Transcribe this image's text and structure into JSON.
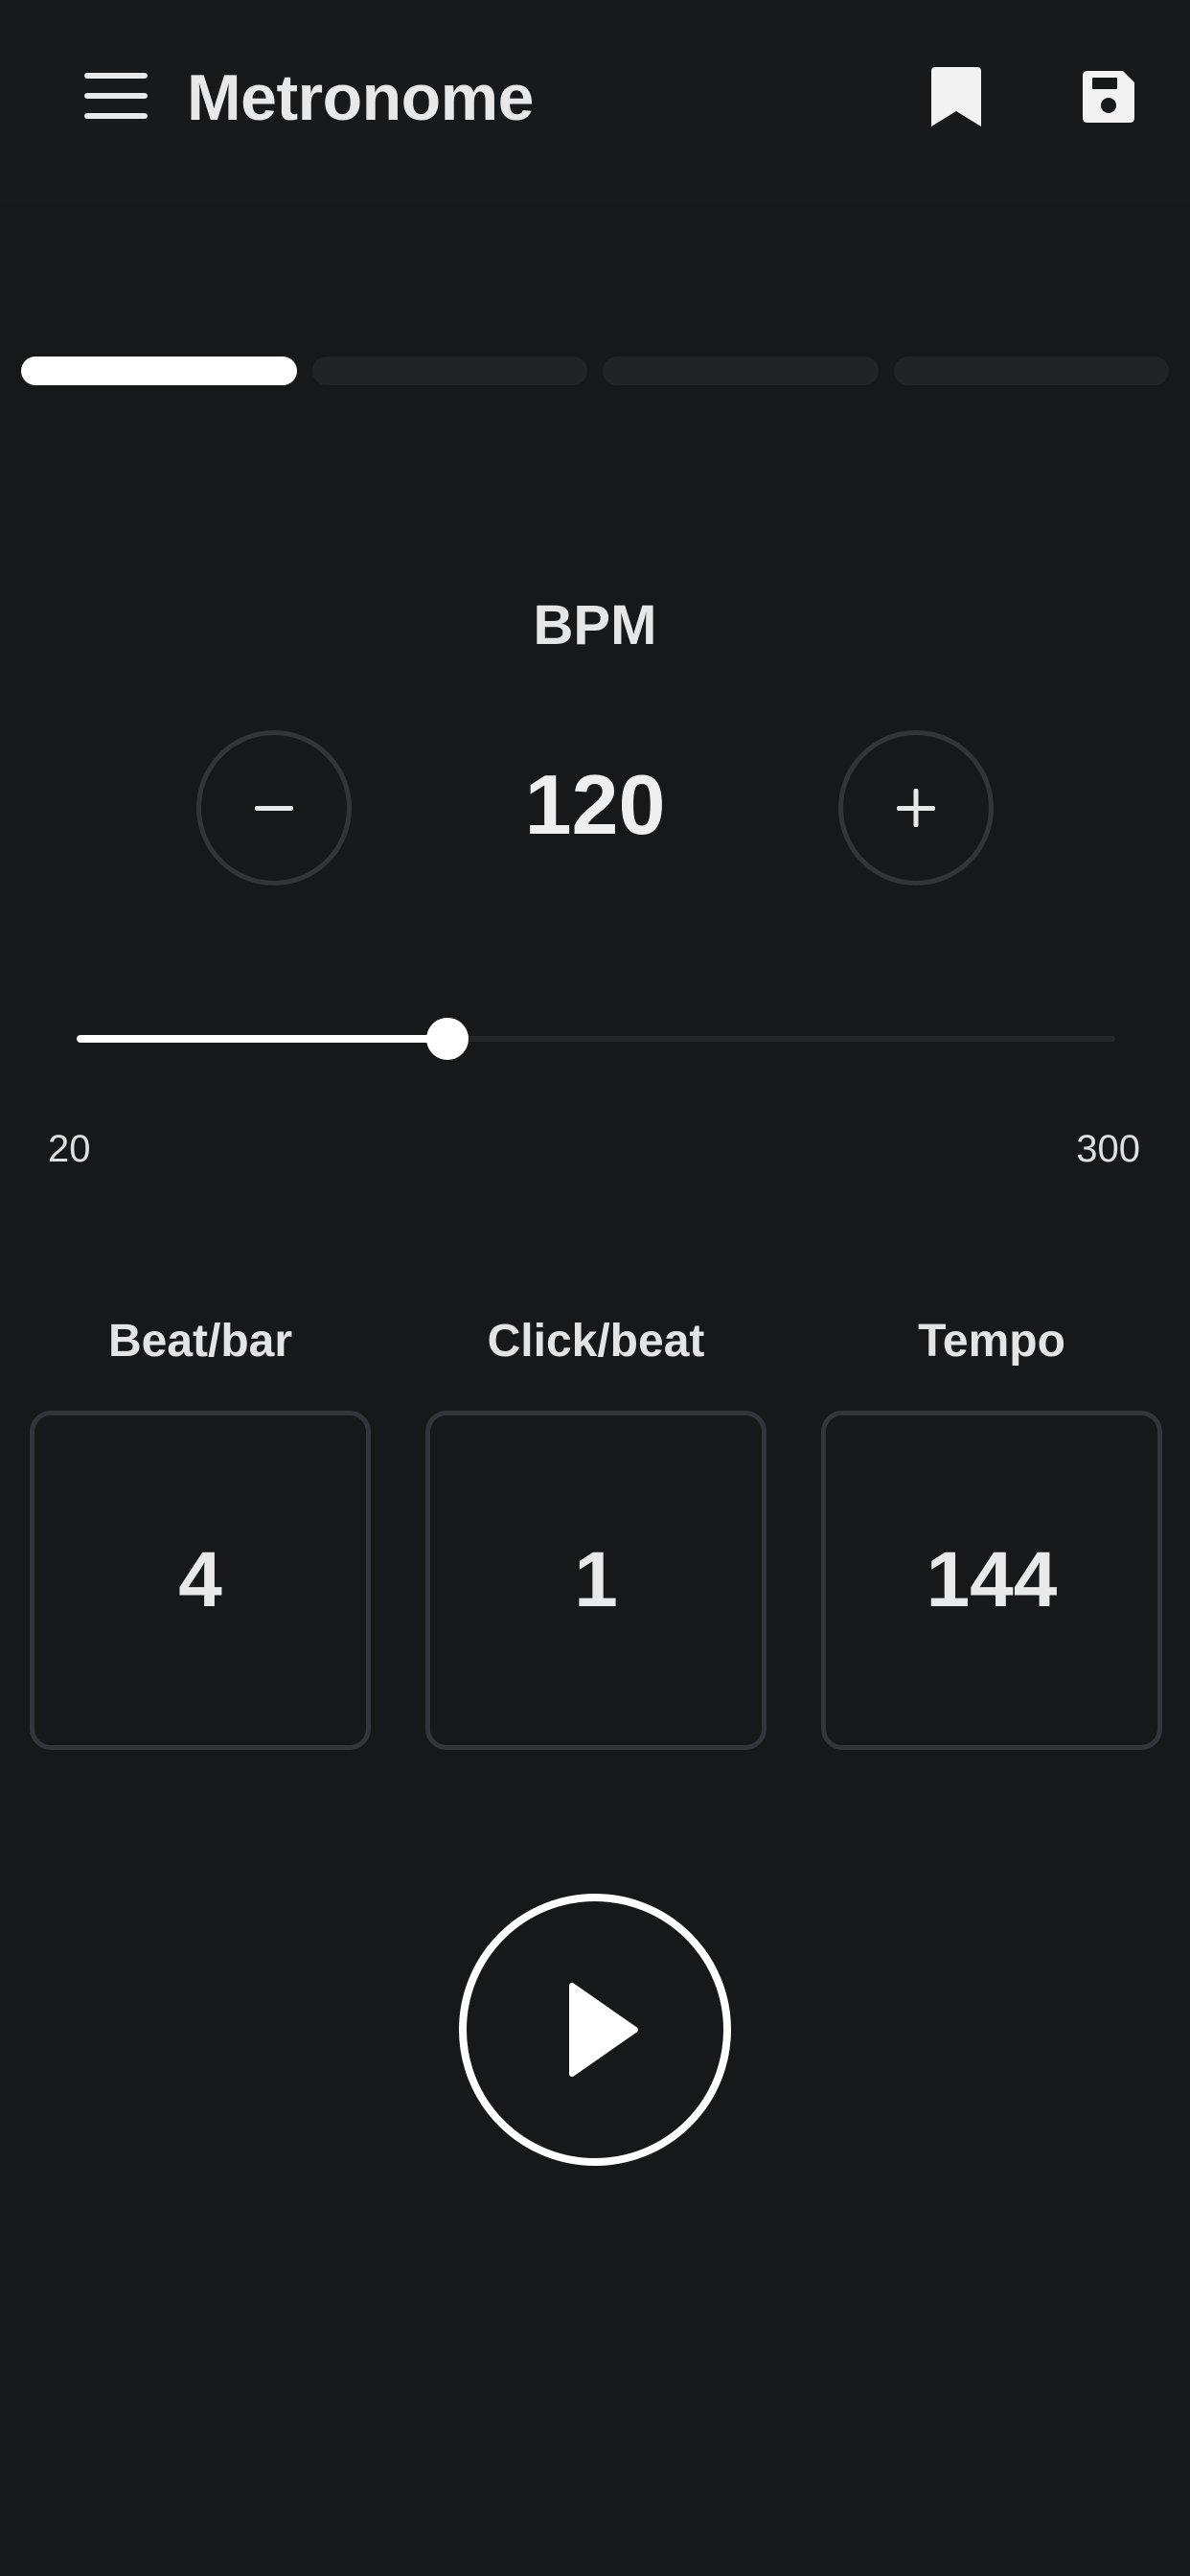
{
  "app_bar": {
    "title": "Metronome",
    "icons": {
      "menu": "menu-icon",
      "bookmark": "bookmark-icon",
      "save": "save-icon"
    }
  },
  "pager": {
    "total": 4,
    "active_index": 0
  },
  "bpm": {
    "label": "BPM",
    "value": "120",
    "decrement_icon": "minus-icon",
    "increment_icon": "plus-icon"
  },
  "slider": {
    "min_label": "20",
    "max_label": "300",
    "min": 20,
    "max": 300,
    "value": 120
  },
  "settings": [
    {
      "label": "Beat/bar",
      "value": "4"
    },
    {
      "label": "Click/beat",
      "value": "1"
    },
    {
      "label": "Tempo",
      "value": "144"
    }
  ],
  "play": {
    "icon": "play-icon"
  },
  "colors": {
    "background": "#17181a",
    "accent": "#ffffff",
    "inactive_segment": "#222326",
    "outline": "#333437",
    "text": "#e6e6e6"
  }
}
